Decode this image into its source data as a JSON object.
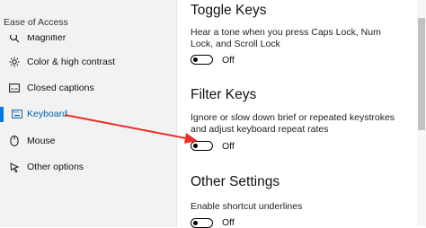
{
  "sidebar": {
    "title": "Ease of Access",
    "items": [
      {
        "label": "Magnifier",
        "icon": "magnifier-icon"
      },
      {
        "label": "Color & high contrast",
        "icon": "color-contrast-icon"
      },
      {
        "label": "Closed captions",
        "icon": "closed-captions-icon"
      },
      {
        "label": "Keyboard",
        "icon": "keyboard-icon",
        "active": true
      },
      {
        "label": "Mouse",
        "icon": "mouse-icon"
      },
      {
        "label": "Other options",
        "icon": "other-options-icon"
      }
    ]
  },
  "main": {
    "sections": [
      {
        "title": "Toggle Keys",
        "description": "Hear a tone when you press Caps Lock, Num Lock, and Scroll Lock",
        "toggle_state": "Off"
      },
      {
        "title": "Filter Keys",
        "description": "Ignore or slow down brief or repeated keystrokes and adjust keyboard repeat rates",
        "toggle_state": "Off"
      },
      {
        "title": "Other Settings",
        "description": "Enable shortcut underlines",
        "toggle_state": "Off"
      }
    ]
  },
  "colors": {
    "accent": "#0078d7",
    "annotation_arrow": "#e8302a",
    "sidebar_bg": "#f2f2f2"
  }
}
